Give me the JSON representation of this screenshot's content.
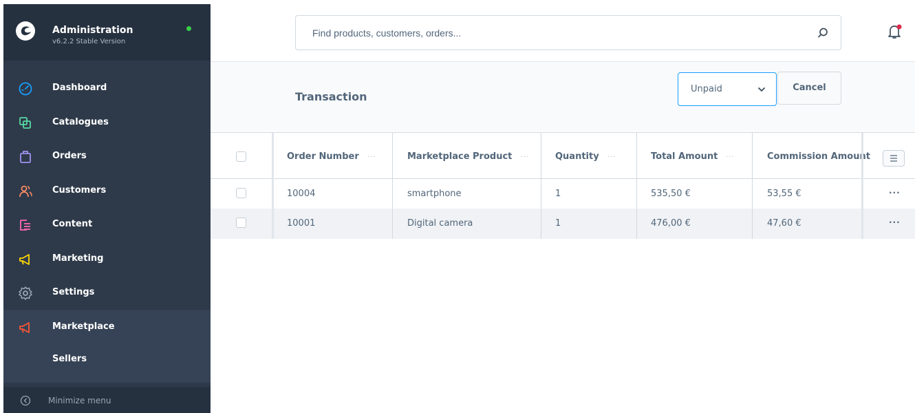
{
  "app": {
    "title": "Administration",
    "version": "v6.2.2 Stable Version",
    "status_color": "#37d046"
  },
  "sidebar": {
    "items": [
      {
        "label": "Dashboard",
        "icon": "dashboard-icon",
        "color": "#189eff"
      },
      {
        "label": "Catalogues",
        "icon": "catalogues-icon",
        "color": "#57d9a3"
      },
      {
        "label": "Orders",
        "icon": "orders-icon",
        "color": "#a092f0"
      },
      {
        "label": "Customers",
        "icon": "customers-icon",
        "color": "#f88962"
      },
      {
        "label": "Content",
        "icon": "content-icon",
        "color": "#ff68b4"
      },
      {
        "label": "Marketing",
        "icon": "marketing-icon",
        "color": "#ffd700"
      },
      {
        "label": "Settings",
        "icon": "settings-icon",
        "color": "#9aa8b5"
      },
      {
        "label": "Marketplace",
        "icon": "marketplace-icon",
        "color": "#ff5533",
        "active": true
      }
    ],
    "sub_items": [
      {
        "label": "Sellers"
      }
    ],
    "minimize_label": "Minimize menu"
  },
  "search": {
    "placeholder": "Find products, customers, orders..."
  },
  "page": {
    "title": "Transaction",
    "filter": {
      "value": "Unpaid"
    },
    "cancel_label": "Cancel"
  },
  "table": {
    "columns": [
      "Order Number",
      "Marketplace Product",
      "Quantity",
      "Total Amount",
      "Commission Amount"
    ],
    "header_dots": "···",
    "row_action": "···",
    "rows": [
      {
        "order_number": "10004",
        "product": "smartphone",
        "quantity": "1",
        "total": "535,50 €",
        "commission": "53,55 €"
      },
      {
        "order_number": "10001",
        "product": "Digital camera",
        "quantity": "1",
        "total": "476,00 €",
        "commission": "47,60 €"
      }
    ]
  },
  "notification": {
    "badge_color": "#de294c"
  }
}
